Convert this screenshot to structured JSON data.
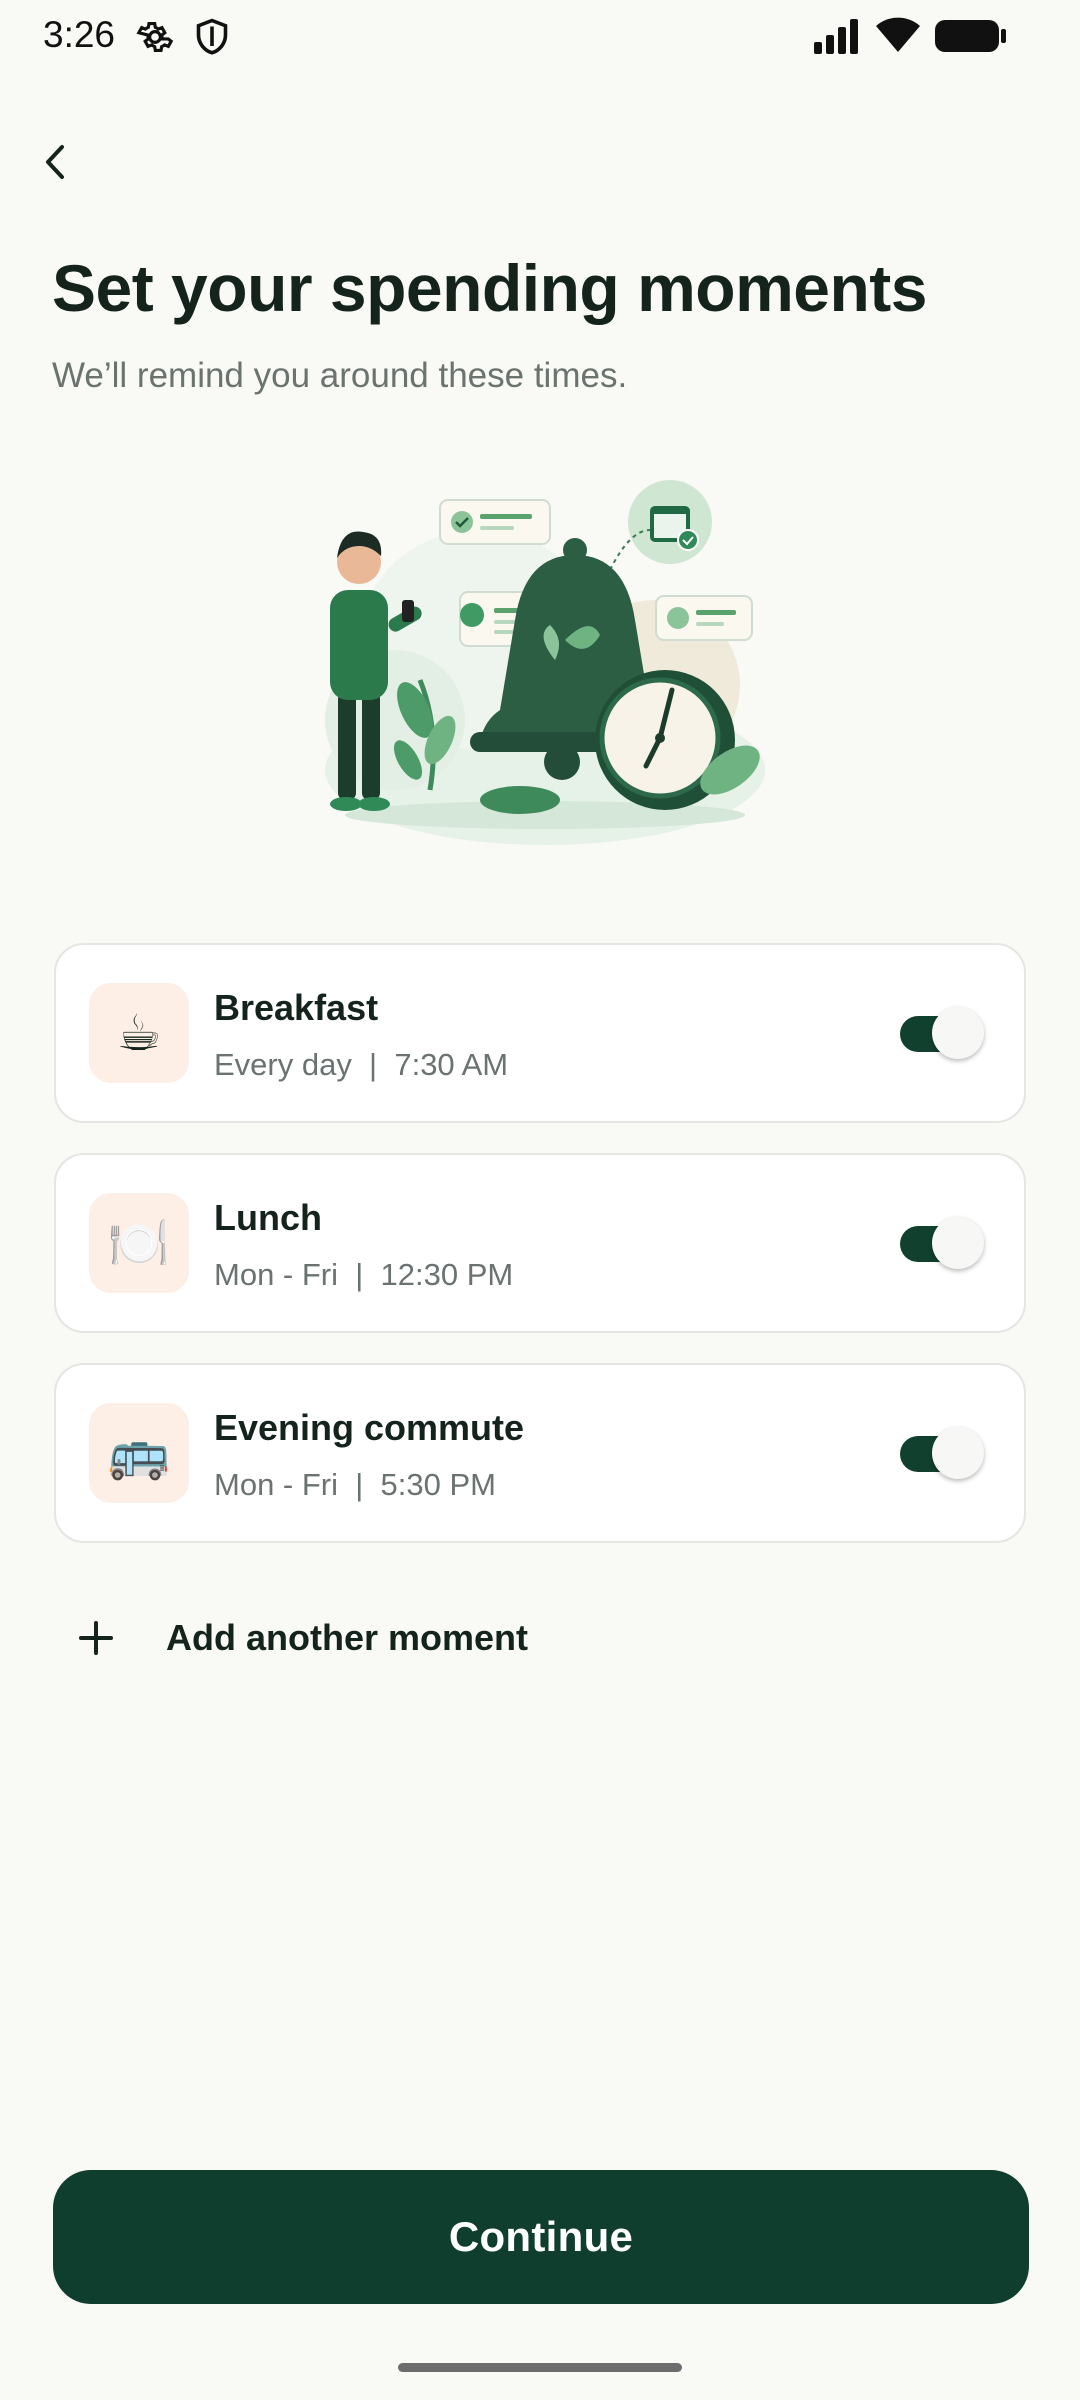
{
  "status_bar": {
    "time": "3:26",
    "icons": [
      "gear-icon",
      "shield-icon",
      "signal-icon",
      "wifi-icon",
      "battery-icon"
    ]
  },
  "header": {
    "back_icon": "chevron-left-icon",
    "title": "Set your spending moments",
    "subtitle": "We’ll remind you around these times."
  },
  "illustration": {
    "subject": "person-with-phone-bell-and-clock"
  },
  "moments": [
    {
      "title": "Breakfast",
      "schedule": "Every day  |  7:30 AM",
      "icon": "coffee-cup-icon",
      "emoji": "☕",
      "enabled": true
    },
    {
      "title": "Lunch",
      "schedule": "Mon - Fri  |  12:30 PM",
      "icon": "plate-cutlery-icon",
      "emoji": "🍽️",
      "enabled": true
    },
    {
      "title": "Evening commute",
      "schedule": "Mon - Fri  |  5:30 PM",
      "icon": "bus-icon",
      "emoji": "🚌",
      "enabled": true
    }
  ],
  "add_moment": {
    "label": "Add another moment",
    "icon": "plus-icon"
  },
  "footer": {
    "continue_label": "Continue"
  },
  "colors": {
    "background": "#f9f9f6",
    "primary": "#0f3d2e",
    "accent_green": "#2e7d4f",
    "icon_tile": "#fdeee6",
    "muted_text": "#6b736f"
  }
}
